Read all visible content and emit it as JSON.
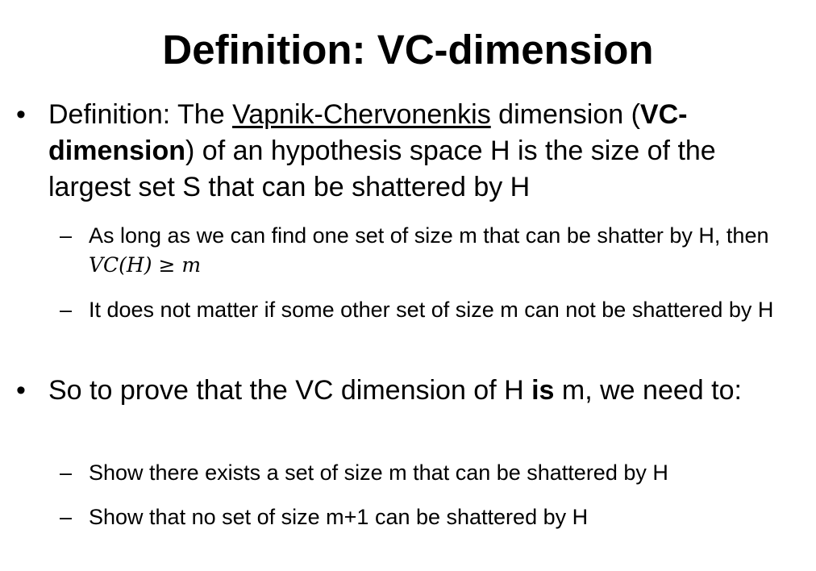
{
  "slide": {
    "title": "Definition: VC-dimension",
    "bullet1": {
      "marker": "•",
      "part1": "Definition: The ",
      "link": "Vapnik-Chervonenkis",
      "part2": " dimension (",
      "bold": "VC-dimension",
      "part3": ") of an hypothesis space H is the size of the largest set S that can be shattered by H"
    },
    "sub1": {
      "marker": "–",
      "text": "As long as we can find one set of size m that can be shatter by H, then ",
      "math": "VC(H) ≥ m"
    },
    "sub2": {
      "marker": "–",
      "text": "It does not matter if some other set of size m can not be shattered by H"
    },
    "bullet2": {
      "marker": "•",
      "part1": "So to prove that the VC dimension of H ",
      "bold": "is",
      "part2": " m, we need to:"
    },
    "sub3": {
      "marker": "–",
      "text": "Show there exists a set of size m that can be shattered by H"
    },
    "sub4": {
      "marker": "–",
      "text": "Show that no set of size m+1 can be shattered by H"
    }
  }
}
